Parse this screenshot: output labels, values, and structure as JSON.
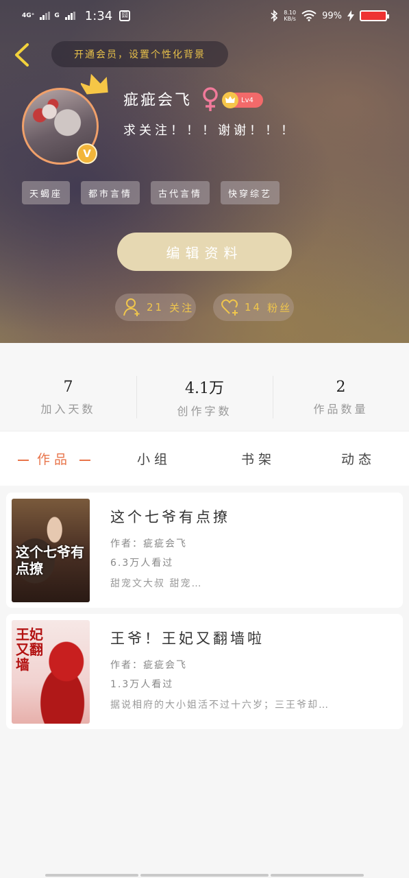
{
  "status_bar": {
    "network_1": "4G⁺",
    "network_2": "G",
    "time": "1:34",
    "notification_box": "囧",
    "speed_value": "8.10",
    "speed_unit": "KB/s",
    "battery": "99%"
  },
  "header": {
    "vip_prompt": "开通会员，设置个性化背景",
    "username": "疵疵会飞",
    "gender_symbol": "♀",
    "level": "Lv4",
    "signature": "求关注！！！谢谢！！！",
    "verified_badge": "V",
    "tags": [
      "天蝎座",
      "都市言情",
      "古代言情",
      "快穿综艺"
    ],
    "edit_button": "编辑资料",
    "following_count": "21",
    "following_label": "关注",
    "fans_count": "14",
    "fans_label": "粉丝"
  },
  "stats": [
    {
      "value": "7",
      "label": "加入天数"
    },
    {
      "value": "4.1万",
      "label": "创作字数"
    },
    {
      "value": "2",
      "label": "作品数量"
    }
  ],
  "tabs": {
    "works": "作品",
    "groups": "小组",
    "bookshelf": "书架",
    "updates": "动态"
  },
  "works": [
    {
      "title": "这个七爷有点撩",
      "author": "作者：疵疵会飞",
      "views": "6.3万人看过",
      "summary": "甜宠文大叔 甜宠…",
      "cover_text": "这个七爷有点撩"
    },
    {
      "title": "王爷！王妃又翻墙啦",
      "author": "作者：疵疵会飞",
      "views": "1.3万人看过",
      "summary": "据说相府的大小姐活不过十六岁；三王爷却…",
      "cover_text": "王妃又翻墙"
    }
  ],
  "colors": {
    "accent": "#e8744a",
    "gold": "#f0c64c",
    "edit_button_bg": "#e6d8b2"
  }
}
